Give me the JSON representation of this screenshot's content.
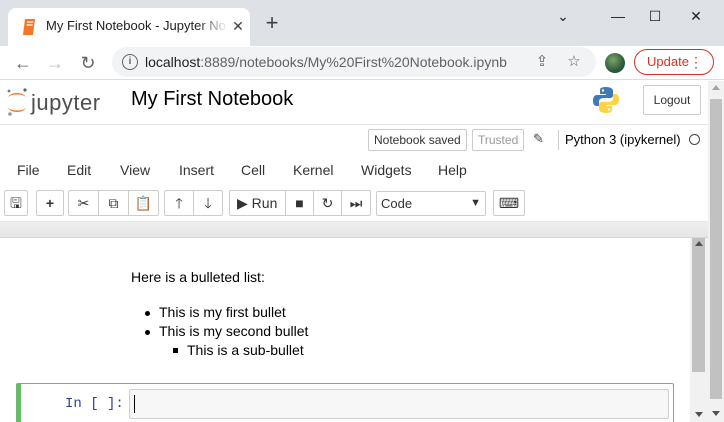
{
  "browser": {
    "tab_title": "My First Notebook - Jupyter Notebook",
    "tab_close_icon": "close-icon",
    "new_tab_label": "+",
    "url_host": "localhost",
    "url_rest": ":8889/notebooks/My%20First%20Notebook.ipynb",
    "update_label": "Update"
  },
  "jupyter": {
    "notebook_title": "My First Notebook",
    "logout_label": "Logout",
    "notebook_saved": "Notebook saved",
    "trusted": "Trusted",
    "kernel": "Python 3 (ipykernel)",
    "menu": [
      "File",
      "Edit",
      "View",
      "Insert",
      "Cell",
      "Kernel",
      "Widgets",
      "Help"
    ],
    "run_label": "Run",
    "cell_type": "Code"
  },
  "notebook": {
    "intro": "Here is a bulleted list:",
    "bullets": [
      "This is my first bullet",
      "This is my second bullet"
    ],
    "sub_bullet": "This is a sub-bullet",
    "prompt": "In [ ]:"
  }
}
